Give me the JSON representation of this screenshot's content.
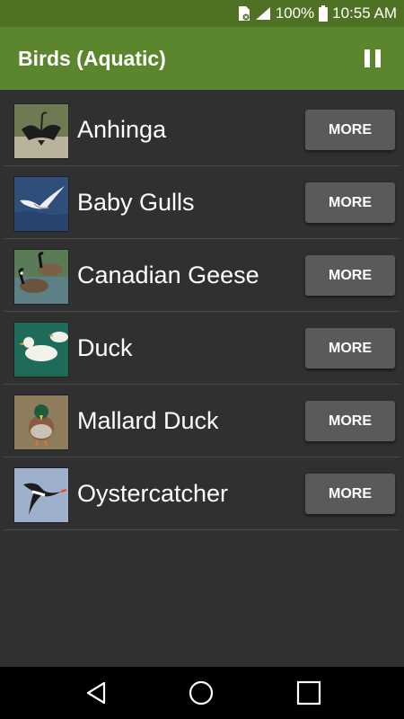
{
  "status_bar": {
    "battery": "100%",
    "time": "10:55 AM"
  },
  "app_bar": {
    "title": "Birds (Aquatic)",
    "pause_icon": "pause-icon"
  },
  "colors": {
    "status_bar": "#4e7123",
    "app_bar": "#5c862d",
    "background": "#303030",
    "button": "#5a5a5a"
  },
  "birds": [
    {
      "name": "Anhinga",
      "button": "MORE"
    },
    {
      "name": "Baby Gulls",
      "button": "MORE"
    },
    {
      "name": "Canadian Geese",
      "button": "MORE"
    },
    {
      "name": "Duck",
      "button": "MORE"
    },
    {
      "name": "Mallard Duck",
      "button": "MORE"
    },
    {
      "name": "Oystercatcher",
      "button": "MORE"
    }
  ],
  "nav_bar": {
    "icons": [
      "back-icon",
      "home-icon",
      "recents-icon"
    ]
  }
}
